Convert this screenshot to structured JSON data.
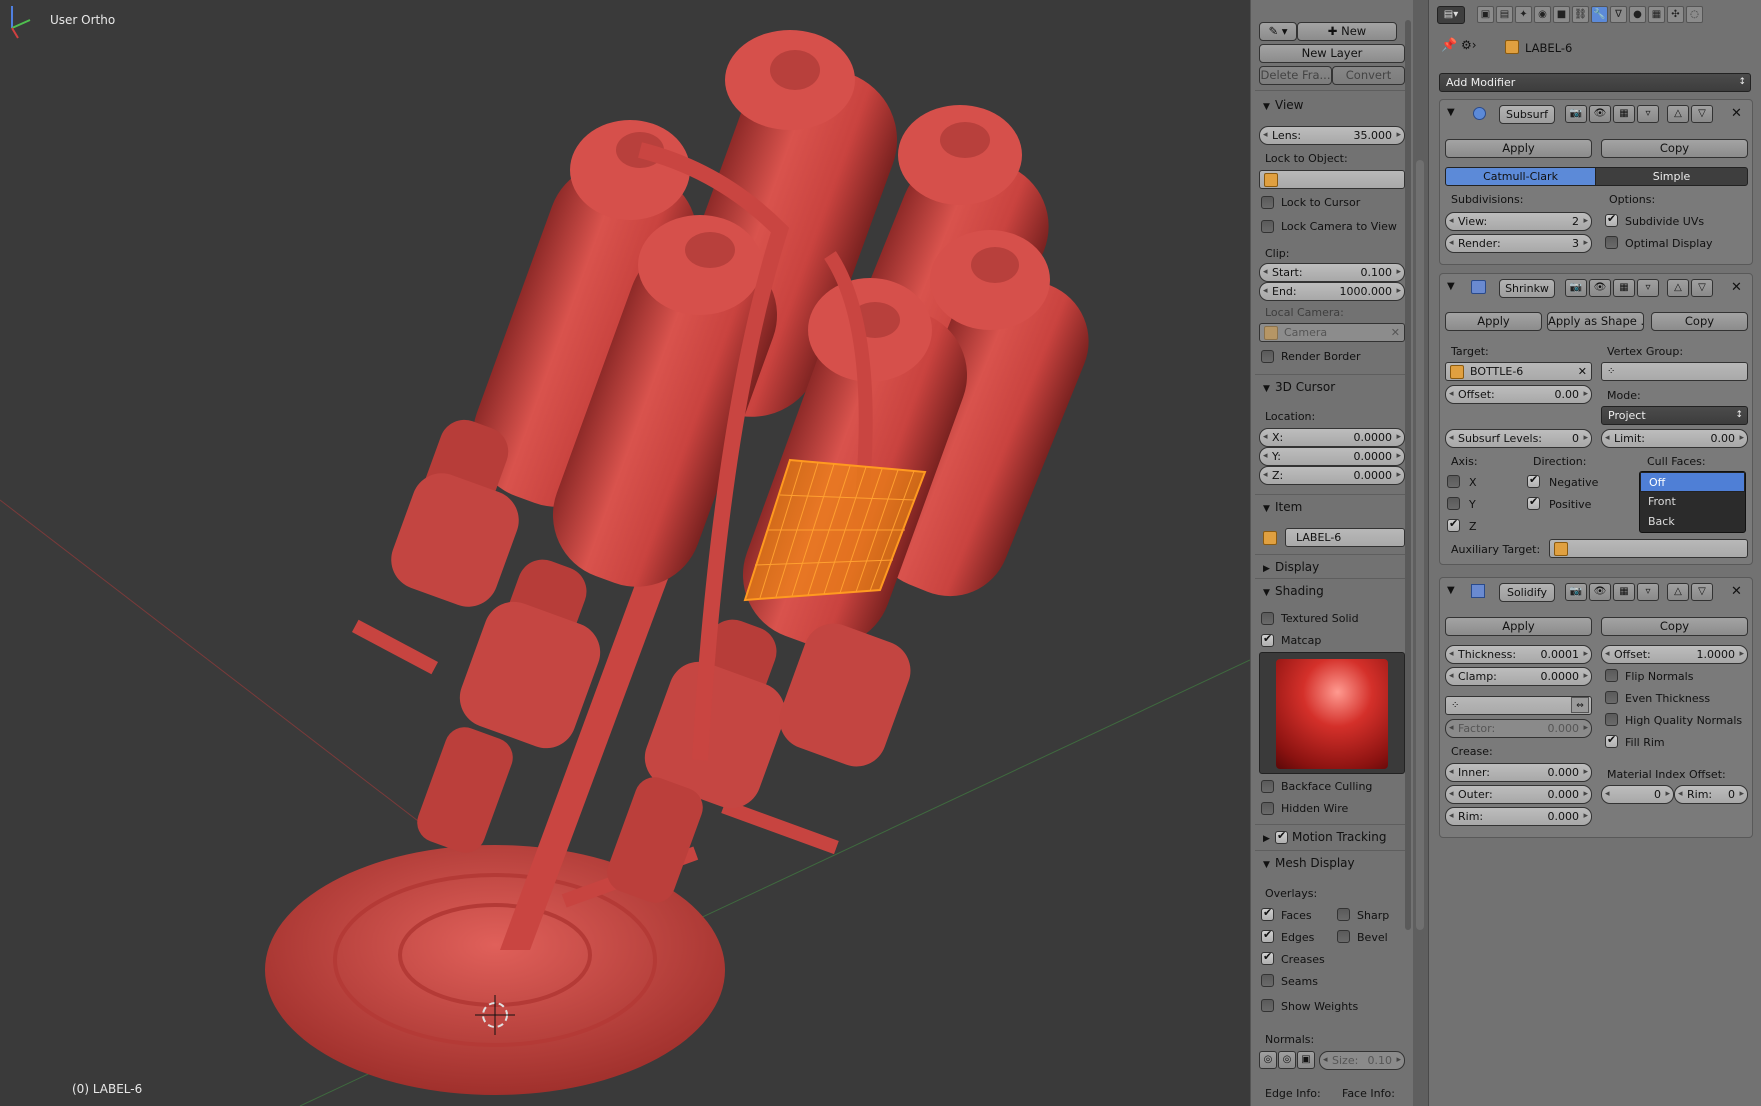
{
  "viewport": {
    "title": "User Ortho",
    "object_label": "(0) LABEL-6"
  },
  "npanel": {
    "grease": {
      "new": "New",
      "new_layer": "New Layer",
      "delete_frame": "Delete Fra...",
      "convert": "Convert"
    },
    "view": {
      "header": "View",
      "lens_label": "Lens:",
      "lens_value": "35.000",
      "lock_to_object": "Lock to Object:",
      "lock_to_cursor": "Lock to Cursor",
      "lock_camera": "Lock Camera to View",
      "clip": "Clip:",
      "start_label": "Start:",
      "start_value": "0.100",
      "end_label": "End:",
      "end_value": "1000.000",
      "local_camera": "Local Camera:",
      "camera": "Camera",
      "render_border": "Render Border"
    },
    "cursor": {
      "header": "3D Cursor",
      "location": "Location:",
      "x_label": "X:",
      "x_value": "0.0000",
      "y_label": "Y:",
      "y_value": "0.0000",
      "z_label": "Z:",
      "z_value": "0.0000"
    },
    "item": {
      "header": "Item",
      "name": "LABEL-6"
    },
    "display": {
      "header": "Display"
    },
    "shading": {
      "header": "Shading",
      "textured_solid": "Textured Solid",
      "matcap": "Matcap",
      "backface_culling": "Backface Culling",
      "hidden_wire": "Hidden Wire"
    },
    "motion_tracking": {
      "header": "Motion Tracking"
    },
    "mesh_display": {
      "header": "Mesh Display",
      "overlays": "Overlays:",
      "faces": "Faces",
      "sharp": "Sharp",
      "edges": "Edges",
      "bevel": "Bevel",
      "creases": "Creases",
      "seams": "Seams",
      "show_weights": "Show Weights",
      "normals": "Normals:",
      "size_label": "Size:",
      "size_value": "0.10",
      "edge_info": "Edge Info:",
      "face_info": "Face Info:"
    }
  },
  "props": {
    "breadcrumb": "LABEL-6",
    "add_modifier": "Add Modifier",
    "subsurf": {
      "name": "Subsurf",
      "apply": "Apply",
      "copy": "Copy",
      "catmull": "Catmull-Clark",
      "simple": "Simple",
      "subdivisions": "Subdivisions:",
      "options": "Options:",
      "view_label": "View:",
      "view_value": "2",
      "render_label": "Render:",
      "render_value": "3",
      "subdivide_uvs": "Subdivide UVs",
      "optimal_display": "Optimal Display"
    },
    "shrinkwrap": {
      "name": "Shrinkw",
      "apply": "Apply",
      "apply_shape": "Apply as Shape ...",
      "copy": "Copy",
      "target": "Target:",
      "target_value": "BOTTLE-6",
      "vertex_group": "Vertex Group:",
      "offset_label": "Offset:",
      "offset_value": "0.00",
      "mode": "Mode:",
      "mode_value": "Project",
      "subsurf_label": "Subsurf Levels:",
      "subsurf_value": "0",
      "limit_label": "Limit:",
      "limit_value": "0.00",
      "axis": "Axis:",
      "direction": "Direction:",
      "cull_faces": "Cull Faces:",
      "x": "X",
      "y": "Y",
      "z": "Z",
      "negative": "Negative",
      "positive": "Positive",
      "cull_options": [
        "Off",
        "Front",
        "Back"
      ],
      "auxiliary": "Auxiliary Target:"
    },
    "solidify": {
      "name": "Solidify",
      "apply": "Apply",
      "copy": "Copy",
      "thickness_label": "Thickness:",
      "thickness_value": "0.0001",
      "offset_label": "Offset:",
      "offset_value": "1.0000",
      "clamp_label": "Clamp:",
      "clamp_value": "0.0000",
      "flip_normals": "Flip Normals",
      "even_thickness": "Even Thickness",
      "high_quality": "High Quality Normals",
      "fill_rim": "Fill Rim",
      "factor_label": "Factor:",
      "factor_value": "0.000",
      "crease": "Crease:",
      "inner_label": "Inner:",
      "inner_value": "0.000",
      "outer_label": "Outer:",
      "outer_value": "0.000",
      "rim_label": "Rim:",
      "rim_value": "0.000",
      "material_index": "Material Index Offset:",
      "mat_value": "0",
      "mat_rim_label": "Rim:",
      "mat_rim_value": "0"
    }
  },
  "colors": {
    "model": "#cf4b46",
    "selection": "#f08a10",
    "accent": "#5c8ad8"
  }
}
